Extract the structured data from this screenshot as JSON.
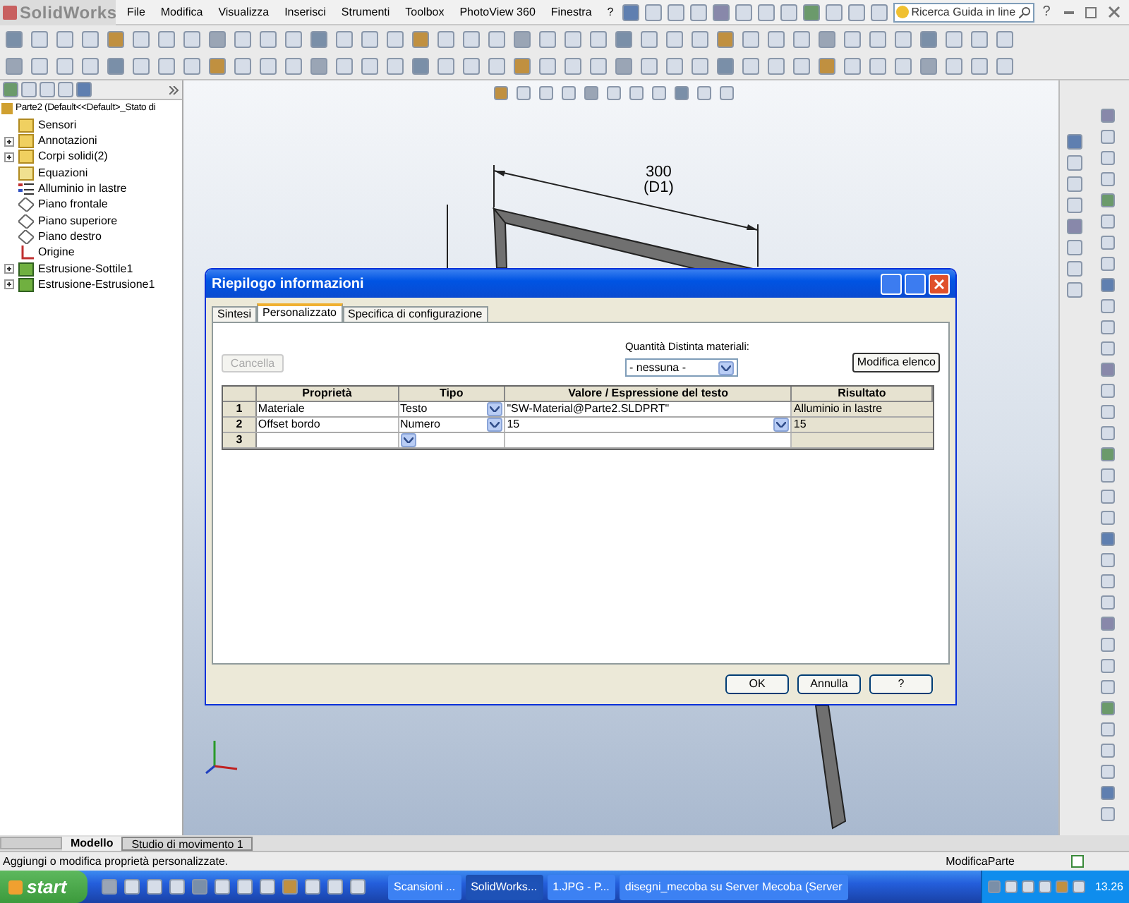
{
  "menu_bar": {
    "logo": "SolidWorks",
    "items": [
      "File",
      "Modifica",
      "Visualizza",
      "Inserisci",
      "Strumenti",
      "Toolbox",
      "PhotoView 360",
      "Finestra",
      "?"
    ]
  },
  "search": {
    "placeholder": "Ricerca Guida in line"
  },
  "help_button": "?",
  "feature_tree": {
    "root": "Parte2  (Default<<Default>_Stato di",
    "items": [
      {
        "label": "Sensori",
        "kind": "folder",
        "expandable": false
      },
      {
        "label": "Annotazioni",
        "kind": "annotation",
        "expandable": true
      },
      {
        "label": "Corpi solidi(2)",
        "kind": "folder",
        "expandable": true
      },
      {
        "label": "Equazioni",
        "kind": "equation",
        "expandable": false
      },
      {
        "label": "Alluminio in lastre",
        "kind": "material",
        "expandable": false
      },
      {
        "label": "Piano frontale",
        "kind": "plane",
        "expandable": false
      },
      {
        "label": "Piano superiore",
        "kind": "plane",
        "expandable": false
      },
      {
        "label": "Piano destro",
        "kind": "plane",
        "expandable": false
      },
      {
        "label": "Origine",
        "kind": "origin",
        "expandable": false
      },
      {
        "label": "Estrusione-Sottile1",
        "kind": "feature",
        "expandable": true
      },
      {
        "label": "Estrusione-Estrusione1",
        "kind": "feature",
        "expandable": true
      }
    ]
  },
  "viewport": {
    "dimension_value": "300",
    "dimension_name": "(D1)"
  },
  "dialog": {
    "title": "Riepilogo informazioni",
    "tabs": [
      {
        "label": "Sintesi",
        "selected": false
      },
      {
        "label": "Personalizzato",
        "selected": true
      },
      {
        "label": "Specifica di configurazione",
        "selected": false
      }
    ],
    "delete_button": {
      "label": "Cancella",
      "disabled": true
    },
    "bom_label": "Quantità Distinta materiali:",
    "bom_value": "- nessuna -",
    "edit_list_button": "Modifica elenco",
    "columns": [
      "Proprietà",
      "Tipo",
      "Valore / Espressione del testo",
      "Risultato"
    ],
    "rows": [
      {
        "number": "1",
        "property": "Materiale",
        "type": "Testo",
        "value": "\"SW-Material@Parte2.SLDPRT\"",
        "result": "Alluminio in lastre",
        "value_dropdown": false
      },
      {
        "number": "2",
        "property": "Offset bordo",
        "type": "Numero",
        "value": "15",
        "result": "15",
        "value_dropdown": true
      },
      {
        "number": "3",
        "property": "",
        "type": "",
        "value": "",
        "result": "",
        "value_dropdown": false
      }
    ],
    "buttons": [
      "OK",
      "Annulla",
      "?"
    ]
  },
  "bottom_tabs": [
    {
      "label": "Modello",
      "selected": true
    },
    {
      "label": "Studio di movimento 1",
      "selected": false
    }
  ],
  "status_bar": {
    "message": "Aggiungi o modifica proprietà personalizzate.",
    "mode": "ModificaParte"
  },
  "taskbar": {
    "start": "start",
    "tasks": [
      {
        "label": "Scansioni ...",
        "selected": false
      },
      {
        "label": "SolidWorks...",
        "selected": true
      },
      {
        "label": "1.JPG - P...",
        "selected": false
      },
      {
        "label": "disegni_mecoba su Server Mecoba (Server",
        "selected": false
      }
    ],
    "clock": "13.26"
  }
}
